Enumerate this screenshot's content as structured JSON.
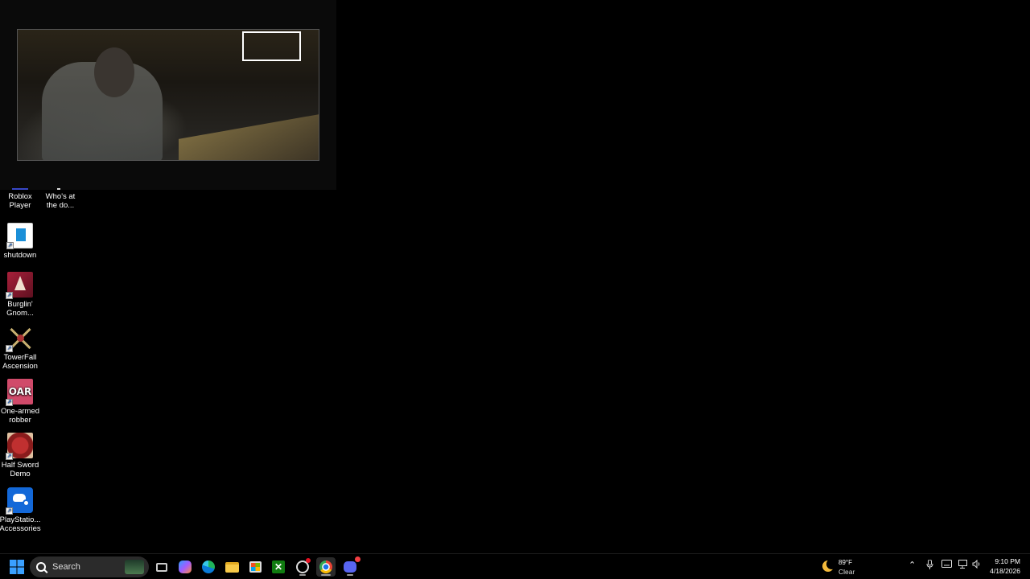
{
  "desktop_icons": [
    {
      "label_line1": "Roblox",
      "label_line2": "Player",
      "icon": "roblox-icon"
    },
    {
      "label_line1": "Who's at",
      "label_line2": "the do...",
      "icon": "whos-at-the-door-icon"
    },
    {
      "label_line1": "shutdown",
      "label_line2": "",
      "icon": "shutdown-shortcut-icon"
    },
    {
      "label_line1": "Burglin'",
      "label_line2": "Gnom...",
      "icon": "burglin-gnomes-icon"
    },
    {
      "label_line1": "TowerFall",
      "label_line2": "Ascension",
      "icon": "towerfall-icon"
    },
    {
      "label_line1": "One-armed",
      "label_line2": "robber",
      "icon": "one-armed-robber-icon"
    },
    {
      "label_line1": "Half Sword",
      "label_line2": "Demo",
      "icon": "half-sword-icon"
    },
    {
      "label_line1": "PlayStatio...",
      "label_line2": "Accessories",
      "icon": "playstation-accessories-icon"
    }
  ],
  "oar_logo_text": "OAR",
  "taskbar": {
    "search_placeholder": "Search",
    "apps": [
      "task-view",
      "copilot",
      "edge",
      "file-explorer",
      "microsoft-store",
      "xbox",
      "obs",
      "chrome",
      "discord"
    ]
  },
  "weather": {
    "temperature": "89°F",
    "condition": "Clear"
  },
  "clock": {
    "time": "9:10 PM",
    "date": "4/18/2026"
  },
  "colors": {
    "accent_start": "#3aa0ff",
    "xbox": "#107c10",
    "chrome_active": "#999999",
    "discord": "#5865f2"
  }
}
